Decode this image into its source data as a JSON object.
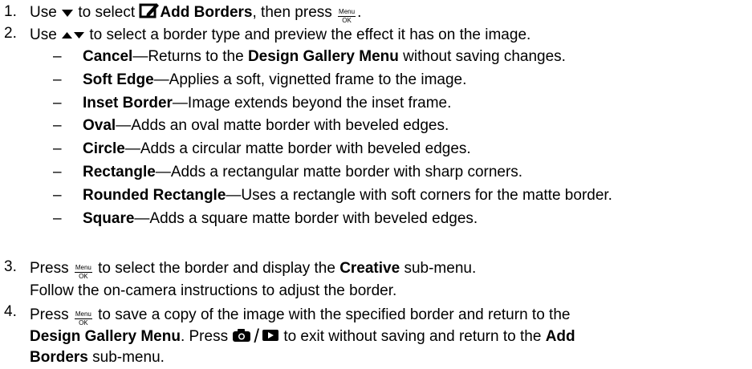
{
  "steps": [
    {
      "num": "1.",
      "a": "Use",
      "b": "to select",
      "bold": "Add Borders",
      "c": ", then press",
      "d": "."
    },
    {
      "num": "2.",
      "a": "Use",
      "b": "to select a border type and preview the effect it has on the image."
    },
    {
      "num": "3.",
      "a": "Press",
      "b": "to select the border and display the",
      "bold": "Creative",
      "c": "sub-menu.",
      "line2": "Follow the on-camera instructions to adjust the border."
    },
    {
      "num": "4.",
      "a": "Press",
      "b": "to save a copy of the image with the specified border and return to the",
      "line2_bold": "Design Gallery Menu",
      "line2_a": ". Press",
      "line2_b": "to exit without saving and return to the",
      "line2_bold2": "Add",
      "line3_bold": "Borders",
      "line3_a": "sub-menu."
    }
  ],
  "menu_ok": {
    "top": "Menu",
    "bottom": "OK"
  },
  "dash": "–",
  "em": "—",
  "options": [
    {
      "name": "Cancel",
      "desc": "Returns to the",
      "desc_bold": "Design Gallery Menu",
      "desc_end": "without saving changes."
    },
    {
      "name": "Soft Edge",
      "desc": "Applies a soft, vignetted frame to the image."
    },
    {
      "name": "Inset Border",
      "desc": "Image extends beyond the inset frame."
    },
    {
      "name": "Oval",
      "desc": "Adds an oval matte border with beveled edges."
    },
    {
      "name": "Circle",
      "desc": "Adds a circular matte border with beveled edges."
    },
    {
      "name": "Rectangle",
      "desc": "Adds a rectangular matte border with sharp corners."
    },
    {
      "name": "Rounded Rectangle",
      "desc": "Uses a rectangle with soft corners for the matte border."
    },
    {
      "name": "Square",
      "desc": "Adds a square matte border with beveled edges."
    }
  ],
  "slash": "/",
  "icons": [
    "down-arrow-icon",
    "add-borders-icon",
    "menu-ok-icon",
    "up-down-arrows-icon",
    "camera-icon",
    "playback-icon"
  ]
}
